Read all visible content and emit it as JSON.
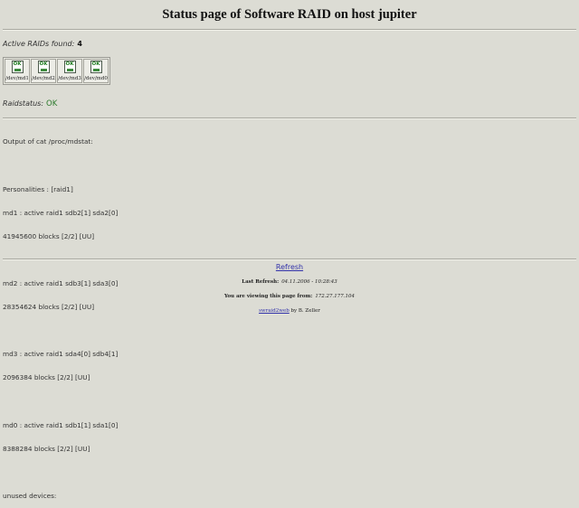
{
  "header": {
    "title": "Status page of Software RAID on host jupiter"
  },
  "summary": {
    "active_label": "Active RAIDs found:",
    "active_count": "4"
  },
  "devices": [
    {
      "status": "OK",
      "label": "/dev/md1",
      "icon": "disk-ok-icon"
    },
    {
      "status": "OK",
      "label": "/dev/md2",
      "icon": "disk-ok-icon"
    },
    {
      "status": "OK",
      "label": "/dev/md3",
      "icon": "disk-ok-icon"
    },
    {
      "status": "OK",
      "label": "/dev/md0",
      "icon": "disk-ok-icon"
    }
  ],
  "raidstatus": {
    "label": "Raidstatus:",
    "value": "OK",
    "value_color": "#2c7a2c"
  },
  "mdstat": {
    "heading": "Output of cat /proc/mdstat:",
    "personalities": "Personalities : [raid1]",
    "arrays": [
      {
        "line1": "md1 : active raid1 sdb2[1] sda2[0]",
        "line2": "41945600 blocks [2/2] [UU]"
      },
      {
        "line1": "md2 : active raid1 sdb3[1] sda3[0]",
        "line2": "28354624 blocks [2/2] [UU]"
      },
      {
        "line1": "md3 : active raid1 sda4[0] sdb4[1]",
        "line2": "2096384 blocks [2/2] [UU]"
      },
      {
        "line1": "md0 : active raid1 sdb1[1] sda1[0]",
        "line2": "8388284 blocks [2/2] [UU]"
      }
    ],
    "unused": "unused devices:"
  },
  "footer": {
    "refresh_label": "Refresh",
    "last_refresh_label": "Last Refresh:",
    "last_refresh_value": "04.11.2006 - 10:28:43",
    "viewing_label": "You are viewing this page from:",
    "viewing_value": "172.27.177.104",
    "credit_link": "swraid2web",
    "credit_text": " by B. Zeller"
  },
  "colors": {
    "background": "#dcdcd4",
    "link": "#3333aa",
    "ok": "#2c7a2c"
  }
}
